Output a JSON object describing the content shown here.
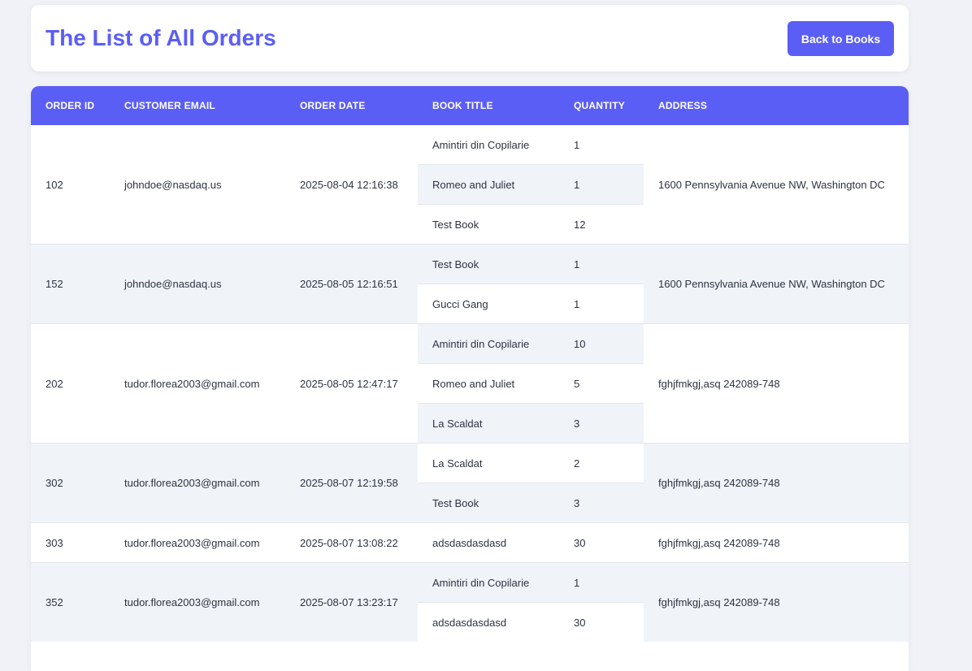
{
  "header": {
    "title": "The List of All Orders",
    "back_label": "Back to Books"
  },
  "table": {
    "columns": [
      "ORDER ID",
      "CUSTOMER EMAIL",
      "ORDER DATE",
      "BOOK TITLE",
      "QUANTITY",
      "ADDRESS"
    ],
    "orders": [
      {
        "id": "102",
        "email": "johndoe@nasdaq.us",
        "date": "2025-08-04 12:16:38",
        "address": "1600 Pennsylvania Avenue NW, Washington DC",
        "items": [
          {
            "title": "Amintiri din Copilarie",
            "qty": "1"
          },
          {
            "title": "Romeo and Juliet",
            "qty": "1"
          },
          {
            "title": "Test Book",
            "qty": "12"
          }
        ]
      },
      {
        "id": "152",
        "email": "johndoe@nasdaq.us",
        "date": "2025-08-05 12:16:51",
        "address": "1600 Pennsylvania Avenue NW, Washington DC",
        "items": [
          {
            "title": "Test Book",
            "qty": "1"
          },
          {
            "title": "Gucci Gang",
            "qty": "1"
          }
        ]
      },
      {
        "id": "202",
        "email": "tudor.florea2003@gmail.com",
        "date": "2025-08-05 12:47:17",
        "address": "fghjfmkgj,asq 242089-748",
        "items": [
          {
            "title": "Amintiri din Copilarie",
            "qty": "10"
          },
          {
            "title": "Romeo and Juliet",
            "qty": "5"
          },
          {
            "title": "La Scaldat",
            "qty": "3"
          }
        ]
      },
      {
        "id": "302",
        "email": "tudor.florea2003@gmail.com",
        "date": "2025-08-07 12:19:58",
        "address": "fghjfmkgj,asq 242089-748",
        "items": [
          {
            "title": "La Scaldat",
            "qty": "2"
          },
          {
            "title": "Test Book",
            "qty": "3"
          }
        ]
      },
      {
        "id": "303",
        "email": "tudor.florea2003@gmail.com",
        "date": "2025-08-07 13:08:22",
        "address": "fghjfmkgj,asq 242089-748",
        "items": [
          {
            "title": "adsdasdasdasd",
            "qty": "30"
          }
        ]
      },
      {
        "id": "352",
        "email": "tudor.florea2003@gmail.com",
        "date": "2025-08-07 13:23:17",
        "address": "fghjfmkgj,asq 242089-748",
        "items": [
          {
            "title": "Amintiri din Copilarie",
            "qty": "1"
          },
          {
            "title": "adsdasdasdasd",
            "qty": "30"
          }
        ]
      }
    ]
  },
  "colors": {
    "accent": "#5b5ef4",
    "row_white": "#ffffff",
    "row_alt": "#f0f3f8",
    "border": "#e3e7ee"
  }
}
